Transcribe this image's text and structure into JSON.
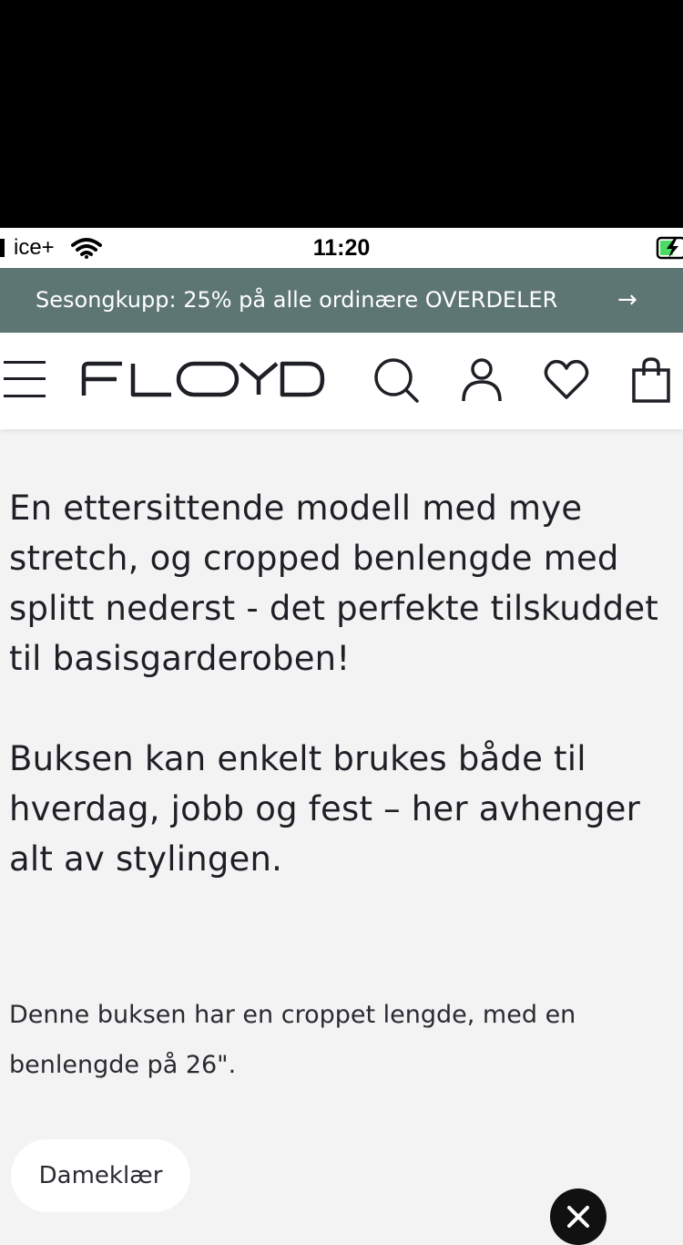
{
  "status_bar": {
    "carrier": "ice+",
    "time": "11:20"
  },
  "promo": {
    "text": "Sesongkupp: 25% på alle ordinære OVERDELER",
    "arrow": "→"
  },
  "header": {
    "logo": "FLOYD",
    "icons": [
      "menu-icon",
      "search-icon",
      "user-icon",
      "heart-icon",
      "bag-icon"
    ]
  },
  "description": {
    "paragraph1": "En ettersittende modell med mye stretch, og cropped benlengde med splitt nederst - det perfekte tilskuddet til basisgarderoben!",
    "paragraph2": "Buksen kan enkelt brukes både til hverdag, jobb og fest – her avhenger alt av stylingen.",
    "paragraph3": "Denne buksen har en croppet lengde, med en benlengde på 26\"."
  },
  "footer": {
    "category_pill": "Dameklær"
  },
  "colors": {
    "promo_bg": "#5d7573",
    "text": "#1f2026",
    "page_bg": "#f3f3f3"
  }
}
